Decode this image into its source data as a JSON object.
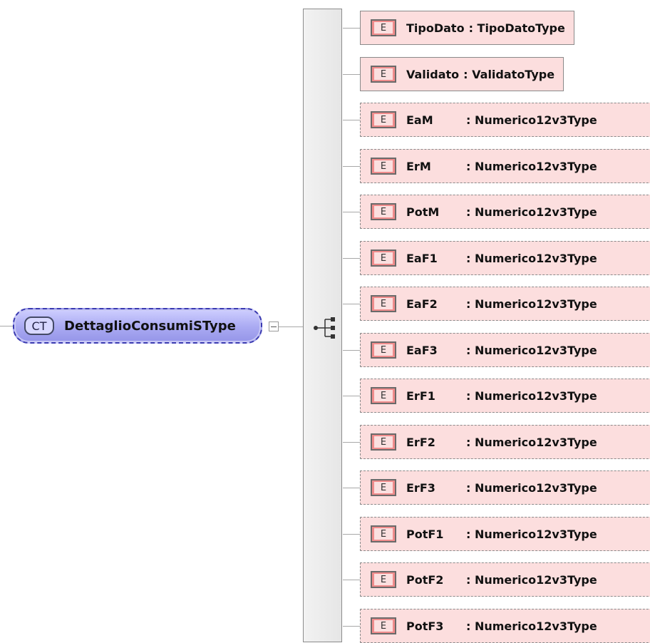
{
  "complex_type": {
    "badge": "CT",
    "name": "DettaglioConsumiSType"
  },
  "compositor_icon": "sequence-icon",
  "elements": [
    {
      "badge": "E",
      "name": "TipoDato",
      "type": ": TipoDatoType",
      "required": true
    },
    {
      "badge": "E",
      "name": "Validato",
      "type": ": ValidatoType",
      "required": true
    },
    {
      "badge": "E",
      "name": "EaM",
      "type": ": Numerico12v3Type",
      "required": false
    },
    {
      "badge": "E",
      "name": "ErM",
      "type": ": Numerico12v3Type",
      "required": false
    },
    {
      "badge": "E",
      "name": "PotM",
      "type": ": Numerico12v3Type",
      "required": false
    },
    {
      "badge": "E",
      "name": "EaF1",
      "type": ": Numerico12v3Type",
      "required": false
    },
    {
      "badge": "E",
      "name": "EaF2",
      "type": ": Numerico12v3Type",
      "required": false
    },
    {
      "badge": "E",
      "name": "EaF3",
      "type": ": Numerico12v3Type",
      "required": false
    },
    {
      "badge": "E",
      "name": "ErF1",
      "type": ": Numerico12v3Type",
      "required": false
    },
    {
      "badge": "E",
      "name": "ErF2",
      "type": ": Numerico12v3Type",
      "required": false
    },
    {
      "badge": "E",
      "name": "ErF3",
      "type": ": Numerico12v3Type",
      "required": false
    },
    {
      "badge": "E",
      "name": "PotF1",
      "type": ": Numerico12v3Type",
      "required": false
    },
    {
      "badge": "E",
      "name": "PotF2",
      "type": ": Numerico12v3Type",
      "required": false
    },
    {
      "badge": "E",
      "name": "PotF3",
      "type": ": Numerico12v3Type",
      "required": false
    }
  ],
  "colors": {
    "complex_type_fill": "#a9a9f2",
    "complex_type_border": "#3a3ab0",
    "element_fill": "#fcdede",
    "element_badge": "#f08c8c"
  }
}
